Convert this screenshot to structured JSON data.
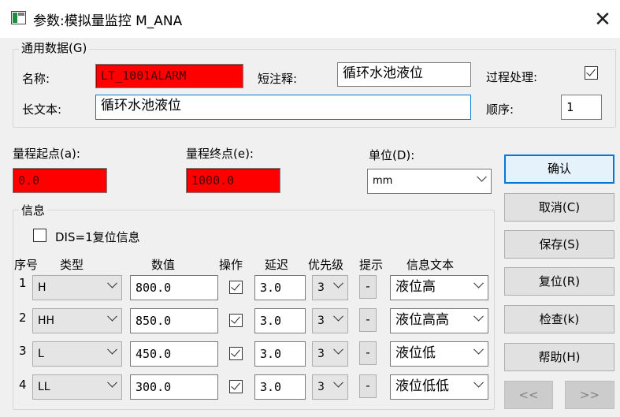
{
  "window": {
    "title": "参数:模拟量监控  M_ANA",
    "close_glyph": "✕"
  },
  "general": {
    "group_label": "通用数据(G)",
    "name_label": "名称:",
    "name_value": "LT_1001ALARM",
    "short_note_label": "短注释:",
    "short_note_value": "循环水池液位",
    "process_label": "过程处理:",
    "process_checked": true,
    "long_text_label": "长文本:",
    "long_text_value": "循环水池液位",
    "order_label": "顺序:",
    "order_value": "1"
  },
  "range": {
    "start_label": "量程起点(a):",
    "start_value": "0.0",
    "end_label": "量程终点(e):",
    "end_value": "1000.0",
    "unit_label": "单位(D):",
    "unit_value": "mm"
  },
  "info": {
    "group_label": "信息",
    "dis_label": "DIS=1复位信息",
    "dis_checked": false,
    "headers": {
      "seq": "序号",
      "type": "类型",
      "value": "数值",
      "op": "操作",
      "delay": "延迟",
      "priority": "优先级",
      "hint": "提示",
      "text": "信息文本"
    },
    "rows": [
      {
        "seq": "1",
        "type": "H",
        "value": "800.0",
        "op": true,
        "delay": "3.0",
        "priority": "3",
        "hint": "-",
        "text": "液位高"
      },
      {
        "seq": "2",
        "type": "HH",
        "value": "850.0",
        "op": true,
        "delay": "3.0",
        "priority": "3",
        "hint": "-",
        "text": "液位高高"
      },
      {
        "seq": "3",
        "type": "L",
        "value": "450.0",
        "op": true,
        "delay": "3.0",
        "priority": "3",
        "hint": "-",
        "text": "液位低"
      },
      {
        "seq": "4",
        "type": "LL",
        "value": "300.0",
        "op": true,
        "delay": "3.0",
        "priority": "3",
        "hint": "-",
        "text": "液位低低"
      }
    ]
  },
  "buttons": {
    "confirm": "确认",
    "cancel": "取消(C)",
    "save": "保存(S)",
    "reset": "复位(R)",
    "check": "检查(k)",
    "help": "帮助(H)",
    "prev": "<<",
    "next": ">>"
  },
  "colors": {
    "alarm_red": "#ff0000",
    "focus_blue": "#0078d7"
  }
}
